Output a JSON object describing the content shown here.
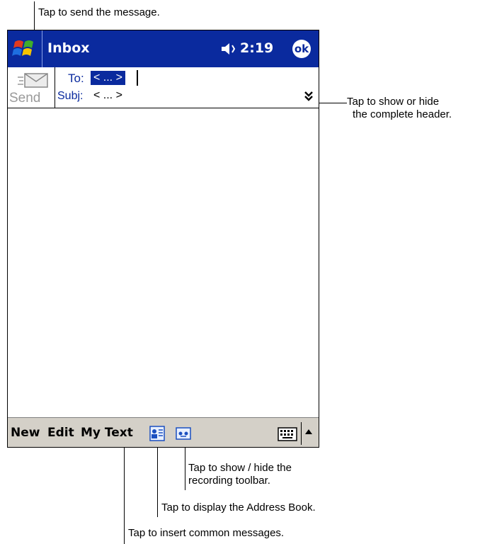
{
  "callouts": {
    "send": "Tap to send the message.",
    "header_line1": "Tap to show or hide",
    "header_line2": "the complete header.",
    "recording_line1": "Tap to show / hide the",
    "recording_line2": "recording toolbar.",
    "address_book": "Tap to display the Address Book.",
    "my_text": "Tap to insert common messages."
  },
  "titlebar": {
    "title": "Inbox",
    "time": "2:19",
    "ok_label": "ok",
    "start_icon": "windows-flag-icon",
    "volume_icon": "speaker-muted-icon"
  },
  "header": {
    "send_label": "Send",
    "send_icon": "envelope-icon",
    "to_label": "To:",
    "to_value": "< ... >",
    "subj_label": "Subj:",
    "subj_value": "< ... >",
    "expand_icon": "double-chevron-down-icon"
  },
  "menubar": {
    "new_label": "New",
    "edit_label": "Edit",
    "mytext_label": "My Text",
    "address_icon": "address-book-icon",
    "recording_icon": "recording-toolbar-icon",
    "keyboard_icon": "keyboard-icon",
    "sip_arrow_icon": "arrow-up-icon"
  },
  "colors": {
    "titlebar_bg": "#0a2a9e",
    "menubar_bg": "#d4d0c8",
    "label_blue": "#0a2a9e"
  }
}
